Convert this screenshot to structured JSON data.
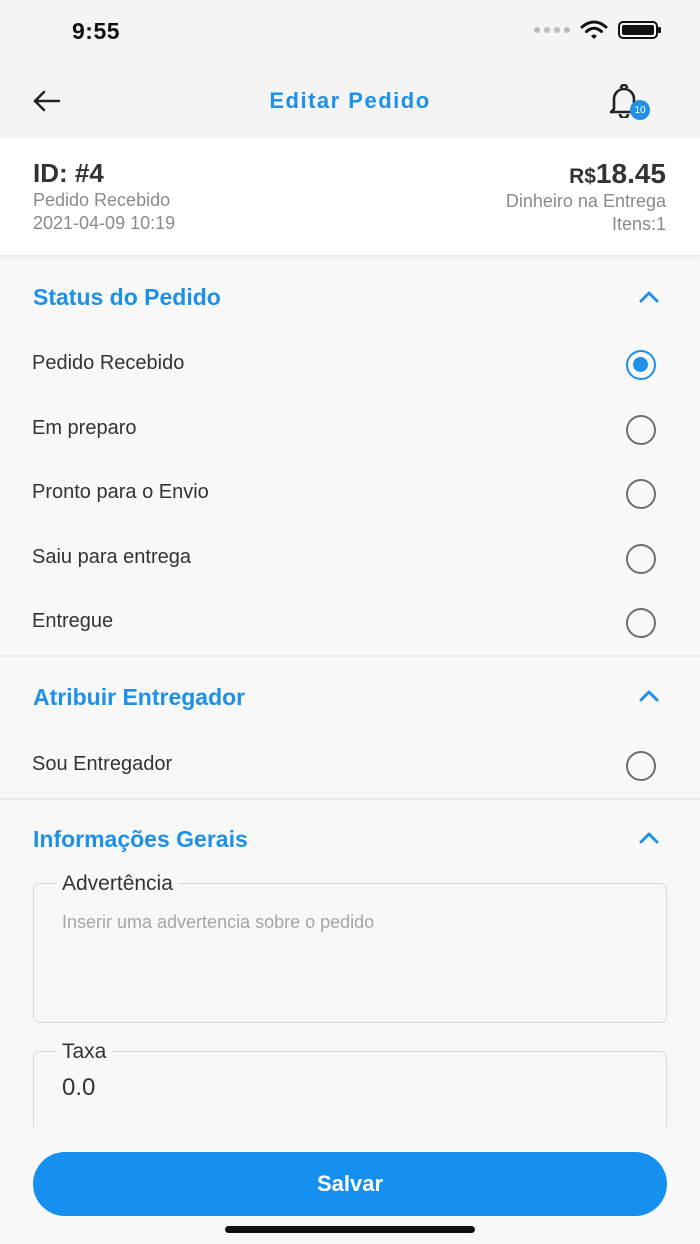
{
  "status_bar": {
    "time": "9:55"
  },
  "header": {
    "title": "Editar Pedido",
    "notification_count": "10"
  },
  "order": {
    "id": "ID: #4",
    "status": "Pedido Recebido",
    "date": "2021-04-09 10:19",
    "currency": "R$",
    "total": "18.45",
    "payment": "Dinheiro na Entrega",
    "items": "Itens:1"
  },
  "status_section": {
    "title": "Status do Pedido",
    "options": [
      {
        "label": "Pedido Recebido",
        "selected": true
      },
      {
        "label": "Em preparo",
        "selected": false
      },
      {
        "label": "Pronto para o Envio",
        "selected": false
      },
      {
        "label": "Saiu para entrega",
        "selected": false
      },
      {
        "label": "Entregue",
        "selected": false
      }
    ]
  },
  "courier_section": {
    "title": "Atribuir Entregador",
    "options": [
      {
        "label": "Sou Entregador",
        "selected": false
      }
    ]
  },
  "info_section": {
    "title": "Informações Gerais",
    "warning": {
      "label": "Advertência",
      "placeholder": "Inserir uma advertencia sobre o pedido",
      "value": ""
    },
    "tax": {
      "label": "Taxa",
      "value": "0.0"
    }
  },
  "footer": {
    "save_label": "Salvar"
  },
  "colors": {
    "accent": "#1e90e8",
    "button": "#1590f0"
  }
}
